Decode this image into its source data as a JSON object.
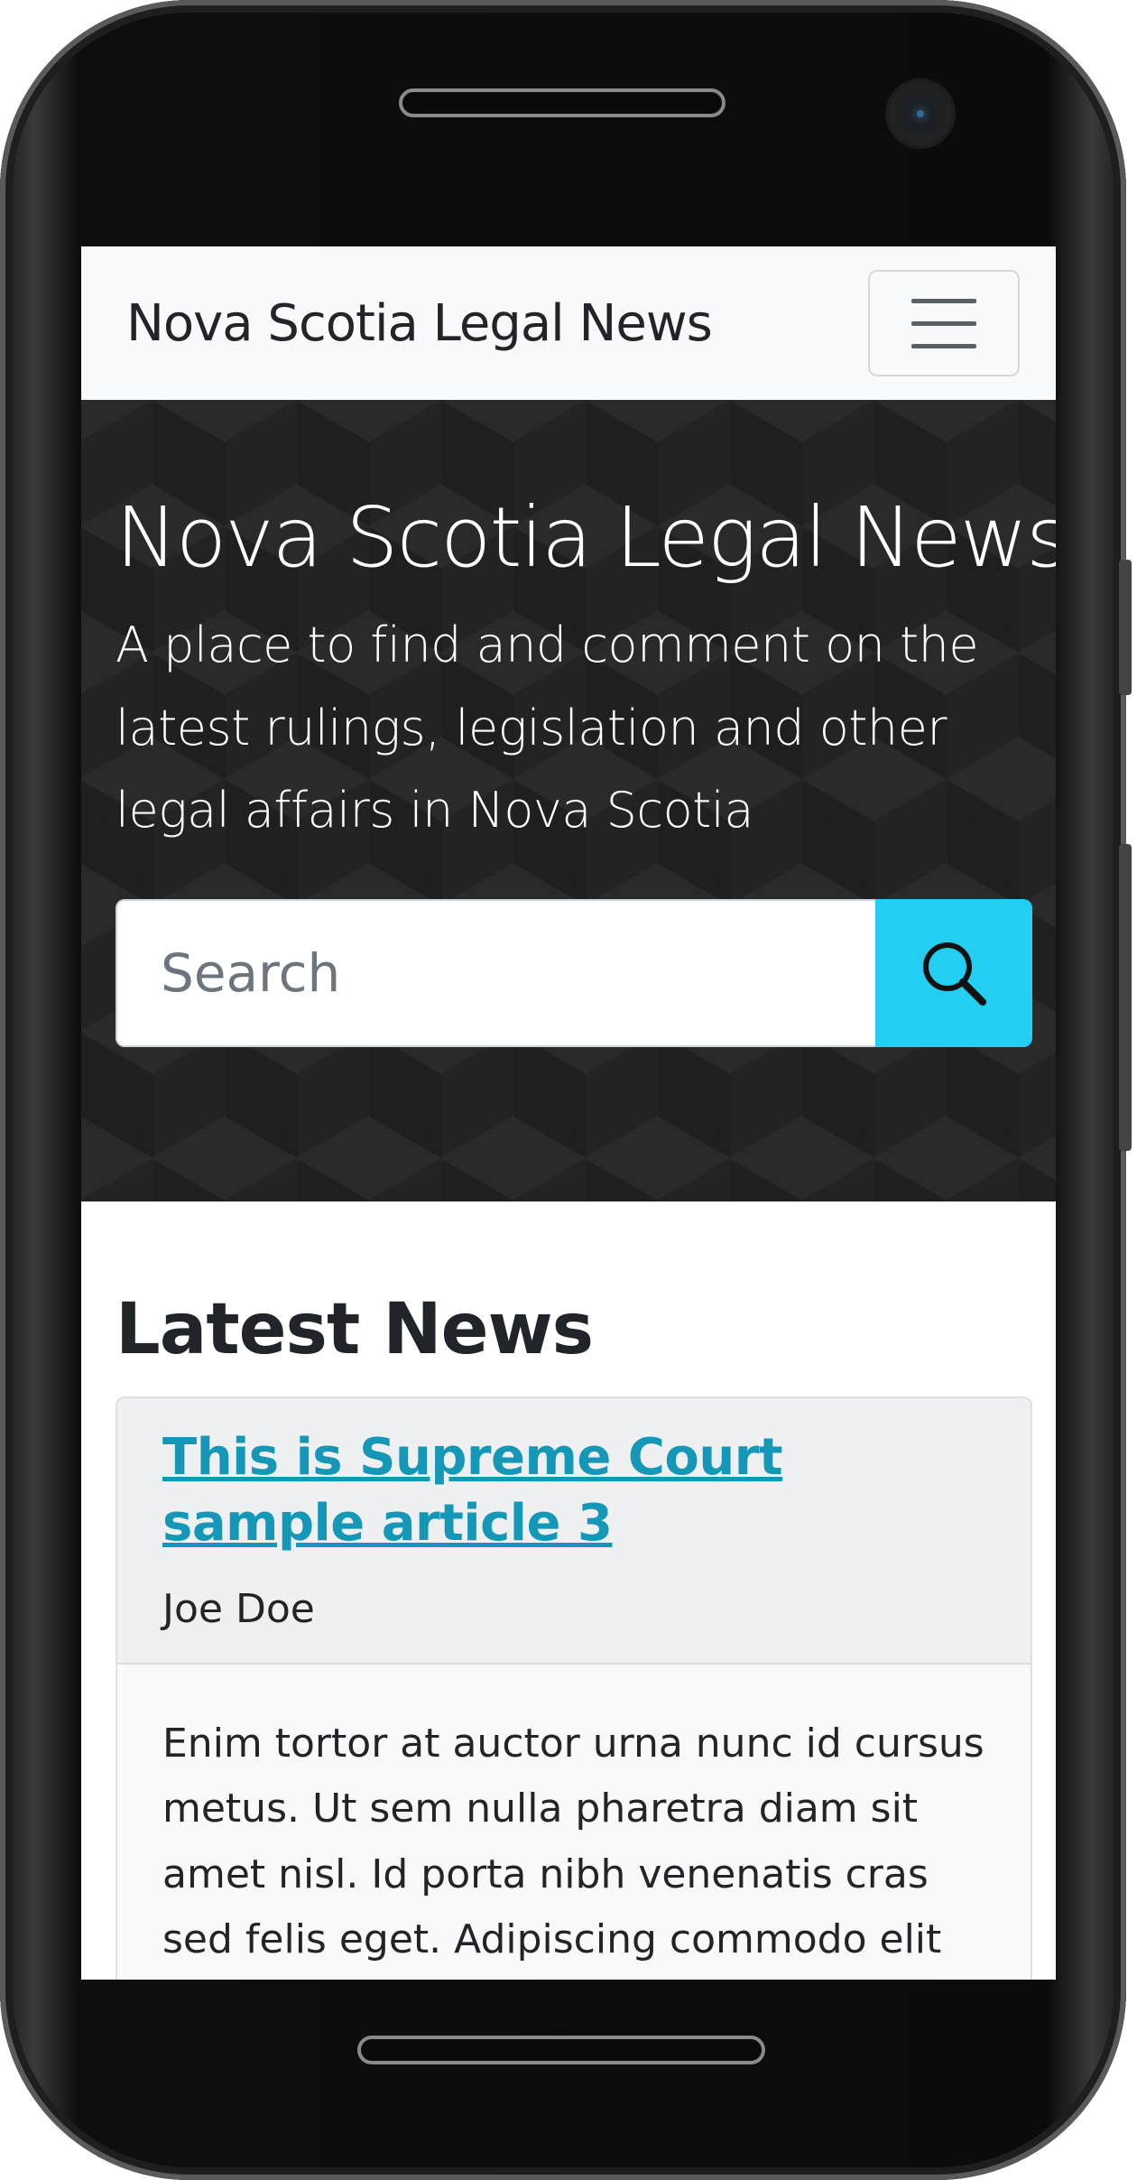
{
  "navbar": {
    "brand": "Nova Scotia Legal News",
    "toggler_icon": "hamburger-menu-icon"
  },
  "hero": {
    "title": "Nova Scotia Legal News",
    "lead": "A place to find and comment on the latest rulings, legislation and other legal affairs in Nova Scotia",
    "search": {
      "placeholder": "Search",
      "button_icon": "search-icon",
      "button_color": "#22cff2"
    }
  },
  "news": {
    "heading": "Latest News",
    "articles": [
      {
        "title": "This is Supreme Court sample article 3",
        "author": "Joe Doe",
        "excerpt": "Enim tortor at auctor urna nunc id cursus metus. Ut sem nulla pharetra diam sit amet nisl. Id porta nibh venenatis cras sed felis eget. Adipiscing commodo elit at"
      }
    ]
  },
  "colors": {
    "link": "#1597b8",
    "navbar_bg": "#f8f9fa",
    "hero_bg": "#232323"
  }
}
